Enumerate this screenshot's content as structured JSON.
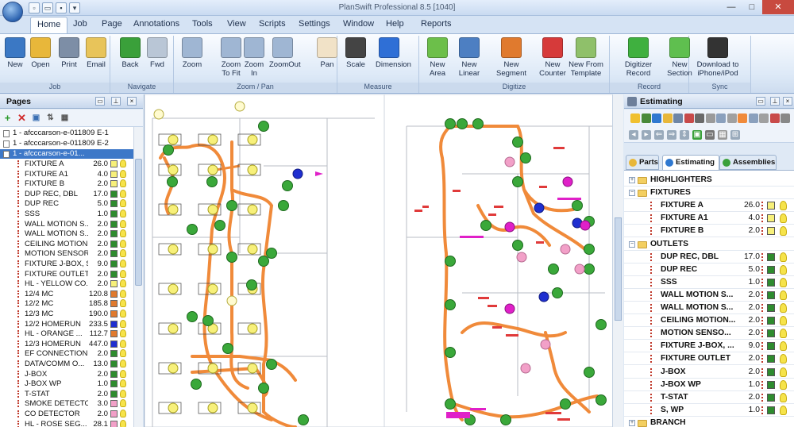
{
  "window": {
    "title": "PlanSwift Professional 8.5   [1040]",
    "minimize": "—",
    "maximize": "□",
    "close": "✕"
  },
  "ribbon_tabs": [
    "Home",
    "Job",
    "Page",
    "Annotations",
    "Tools",
    "View",
    "Scripts",
    "Settings",
    "Window",
    "Help",
    "Reports"
  ],
  "ribbon_groups": [
    {
      "label": "Job",
      "buttons": [
        {
          "label": "New",
          "icon": "new-file-icon",
          "color": "#3b78c4"
        },
        {
          "label": "Open",
          "icon": "open-folder-icon",
          "color": "#e8b73a"
        },
        {
          "label": "Print",
          "icon": "printer-icon",
          "color": "#7d8ea6"
        },
        {
          "label": "Email",
          "icon": "email-icon",
          "color": "#e8c45a"
        }
      ]
    },
    {
      "label": "Navigate",
      "buttons": [
        {
          "label": "Back",
          "icon": "back-arrow-icon",
          "color": "#3aa03a"
        },
        {
          "label": "Fwd",
          "icon": "forward-arrow-icon",
          "color": "#b9c6d6"
        }
      ]
    },
    {
      "label": "Zoom / Pan",
      "buttons": [
        {
          "label": "Zoom",
          "icon": "zoom-icon",
          "color": "#9fb6d3"
        },
        {
          "label": "Zoom\nTo Fit",
          "icon": "zoom-fit-icon",
          "color": "#9fb6d3"
        },
        {
          "label": "Zoom\nIn",
          "icon": "zoom-in-icon",
          "color": "#9fb6d3"
        },
        {
          "label": "ZoomOut",
          "icon": "zoom-out-icon",
          "color": "#9fb6d3"
        },
        {
          "label": "Pan",
          "icon": "pan-hand-icon",
          "color": "#f1e2c7"
        }
      ]
    },
    {
      "label": "Measure",
      "buttons": [
        {
          "label": "Scale",
          "icon": "scale-icon",
          "color": "#444"
        },
        {
          "label": "Dimension",
          "icon": "dimension-icon",
          "color": "#2f6fd6"
        }
      ]
    },
    {
      "label": "Digitize",
      "buttons": [
        {
          "label": "New\nArea",
          "icon": "new-area-icon",
          "color": "#6cbf4a"
        },
        {
          "label": "New\nLinear",
          "icon": "new-linear-icon",
          "color": "#4d7fc2"
        },
        {
          "label": "New\nSegment",
          "icon": "new-segment-icon",
          "color": "#e07a2e"
        },
        {
          "label": "New\nCounter",
          "icon": "new-counter-icon",
          "color": "#d63a3a"
        },
        {
          "label": "New From\nTemplate",
          "icon": "template-icon",
          "color": "#8fc06a"
        }
      ]
    },
    {
      "label": "Record",
      "buttons": [
        {
          "label": "Digitizer\nRecord",
          "icon": "record-icon",
          "color": "#3fb03f"
        },
        {
          "label": "New\nSection",
          "icon": "new-section-icon",
          "color": "#5fbf4f"
        }
      ]
    },
    {
      "label": "Sync",
      "buttons": [
        {
          "label": "Download to\niPhone/iPod",
          "icon": "phone-icon",
          "color": "#333"
        }
      ]
    }
  ],
  "pages_panel": {
    "title": "Pages",
    "pages": [
      "1 - afcccarson-e-011809 E-1",
      "1 - afcccarson-e-011809 E-2",
      "1 - afcccarson-e-01..."
    ],
    "items": [
      {
        "name": "FIXTURE A",
        "value": "26.0",
        "color": "#f7f07a"
      },
      {
        "name": "FIXTURE A1",
        "value": "4.0",
        "color": "#f7f07a"
      },
      {
        "name": "FIXTURE B",
        "value": "2.0",
        "color": "#f7f07a"
      },
      {
        "name": "DUP REC, DBL",
        "value": "17.0",
        "color": "#2e8b2e"
      },
      {
        "name": "DUP REC",
        "value": "5.0",
        "color": "#2e8b2e"
      },
      {
        "name": "SSS",
        "value": "1.0",
        "color": "#2e8b2e"
      },
      {
        "name": "WALL MOTION S...",
        "value": "2.0",
        "color": "#2e8b2e"
      },
      {
        "name": "WALL MOTION S...",
        "value": "2.0",
        "color": "#2e8b2e"
      },
      {
        "name": "CEILING MOTION...",
        "value": "2.0",
        "color": "#2e8b2e"
      },
      {
        "name": "MOTION SENSOR...",
        "value": "2.0",
        "color": "#2e8b2e"
      },
      {
        "name": "FIXTURE J-BOX, SS",
        "value": "9.0",
        "color": "#2e8b2e"
      },
      {
        "name": "FIXTURE OUTLET",
        "value": "2.0",
        "color": "#2e8b2e"
      },
      {
        "name": "HL - YELLOW CO...",
        "value": "2.0",
        "color": "#f7f07a"
      },
      {
        "name": "12/4 MC",
        "value": "120.8",
        "color": "#e07a2e"
      },
      {
        "name": "12/2 MC",
        "value": "185.8",
        "color": "#e07a2e"
      },
      {
        "name": "12/3 MC",
        "value": "190.0",
        "color": "#e07a2e"
      },
      {
        "name": "12/2 HOMERUN",
        "value": "233.5",
        "color": "#1f2fd0"
      },
      {
        "name": "HL - ORANGE ...",
        "value": "112.7",
        "color": "#e07a2e"
      },
      {
        "name": "12/3 HOMERUN",
        "value": "447.0",
        "color": "#1f2fd0"
      },
      {
        "name": "EF CONNECTION ...",
        "value": "2.0",
        "color": "#2e8b2e"
      },
      {
        "name": "DATA/COMM O...",
        "value": "13.0",
        "color": "#2e8b2e"
      },
      {
        "name": "J-BOX",
        "value": "2.0",
        "color": "#2e8b2e"
      },
      {
        "name": "J-BOX WP",
        "value": "1.0",
        "color": "#2e8b2e"
      },
      {
        "name": "T-STAT",
        "value": "2.0",
        "color": "#2e8b2e"
      },
      {
        "name": "SMOKE DETECTOR",
        "value": "3.0",
        "color": "#f2a0c8"
      },
      {
        "name": "CO DETECTOR",
        "value": "2.0",
        "color": "#f2a0c8"
      },
      {
        "name": "HL - ROSE SEG...",
        "value": "28.1",
        "color": "#f2a0c8"
      }
    ]
  },
  "estimating_panel": {
    "title": "Estimating",
    "tabs": [
      "Parts",
      "Estimating",
      "Assemblies"
    ],
    "tree": [
      {
        "type": "group",
        "label": "HIGHLIGHTERS",
        "exp": "+"
      },
      {
        "type": "group",
        "label": "FIXTURES",
        "exp": "−"
      },
      {
        "type": "item",
        "name": "FIXTURE A",
        "value": "26.0",
        "color": "#f7f07a"
      },
      {
        "type": "item",
        "name": "FIXTURE A1",
        "value": "4.0",
        "color": "#f7f07a"
      },
      {
        "type": "item",
        "name": "FIXTURE B",
        "value": "2.0",
        "color": "#f7f07a"
      },
      {
        "type": "group",
        "label": "OUTLETS",
        "exp": "−"
      },
      {
        "type": "item",
        "name": "DUP REC, DBL",
        "value": "17.0",
        "color": "#2e8b2e"
      },
      {
        "type": "item",
        "name": "DUP REC",
        "value": "5.0",
        "color": "#2e8b2e"
      },
      {
        "type": "item",
        "name": "SSS",
        "value": "1.0",
        "color": "#2e8b2e"
      },
      {
        "type": "item",
        "name": "WALL MOTION S...",
        "value": "2.0",
        "color": "#2e8b2e"
      },
      {
        "type": "item",
        "name": "WALL MOTION S...",
        "value": "2.0",
        "color": "#2e8b2e"
      },
      {
        "type": "item",
        "name": "CEILING MOTION...",
        "value": "2.0",
        "color": "#2e8b2e"
      },
      {
        "type": "item",
        "name": "MOTION SENSO...",
        "value": "2.0",
        "color": "#2e8b2e"
      },
      {
        "type": "item",
        "name": "FIXTURE J-BOX, ...",
        "value": "9.0",
        "color": "#2e8b2e"
      },
      {
        "type": "item",
        "name": "FIXTURE OUTLET",
        "value": "2.0",
        "color": "#2e8b2e"
      },
      {
        "type": "item",
        "name": "J-BOX",
        "value": "2.0",
        "color": "#2e8b2e"
      },
      {
        "type": "item",
        "name": "J-BOX WP",
        "value": "1.0",
        "color": "#2e8b2e"
      },
      {
        "type": "item",
        "name": "T-STAT",
        "value": "2.0",
        "color": "#2e8b2e"
      },
      {
        "type": "item",
        "name": "S, WP",
        "value": "1.0",
        "color": "#2e8b2e"
      },
      {
        "type": "group",
        "label": "BRANCH",
        "exp": "+"
      }
    ]
  },
  "colors": {
    "fixture": "#f7f07a",
    "outlet": "#3aa83a",
    "wire": "#f08a3a",
    "homerun": "#1f2fd0",
    "smoke": "#f2a0c8",
    "label": "#e03a3a",
    "magenta": "#e020c8"
  }
}
